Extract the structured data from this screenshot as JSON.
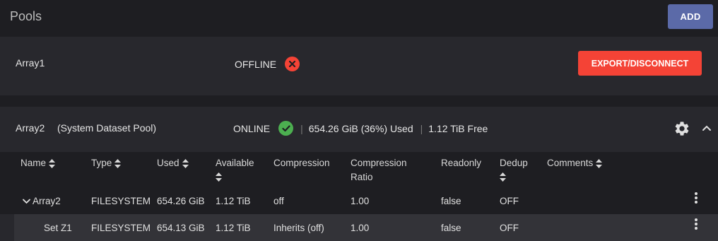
{
  "header": {
    "title": "Pools",
    "add_label": "ADD"
  },
  "pools": [
    {
      "name": "Array1",
      "status": "OFFLINE",
      "status_icon": "error-circle-icon",
      "export_label": "EXPORT/DISCONNECT",
      "colors": {
        "status": "#f44336",
        "button": "#f44336"
      }
    },
    {
      "name": "Array2",
      "subtitle": "(System Dataset Pool)",
      "status": "ONLINE",
      "status_icon": "check-circle-icon",
      "used": "654.26 GiB (36%) Used",
      "free": "1.12 TiB Free",
      "colors": {
        "status": "#4caf50"
      }
    }
  ],
  "table": {
    "columns": [
      {
        "label": "Name",
        "sortable": true
      },
      {
        "label": "Type",
        "sortable": true
      },
      {
        "label": "Used",
        "sortable": true
      },
      {
        "label": "Available",
        "line2": "",
        "sortable": true
      },
      {
        "label": "Compression",
        "sortable": false
      },
      {
        "label": "Compression",
        "line2": "Ratio",
        "sortable": false
      },
      {
        "label": "Readonly",
        "sortable": false
      },
      {
        "label": "Dedup",
        "sortable": true
      },
      {
        "label": "Comments",
        "sortable": true
      }
    ],
    "rows": [
      {
        "name": "Array2",
        "type": "FILESYSTEM",
        "used": "654.26 GiB",
        "available": "1.12 TiB",
        "compression": "off",
        "ratio": "1.00",
        "readonly": "false",
        "dedup": "OFF",
        "comments": ""
      },
      {
        "name": "Set Z1",
        "type": "FILESYSTEM",
        "used": "654.13 GiB",
        "available": "1.12 TiB",
        "compression": "Inherits (off)",
        "ratio": "1.00",
        "readonly": "false",
        "dedup": "OFF",
        "comments": ""
      }
    ]
  },
  "colors": {
    "accent": "#5b6aa8",
    "background": "#1e1e22",
    "card": "#28282d"
  }
}
